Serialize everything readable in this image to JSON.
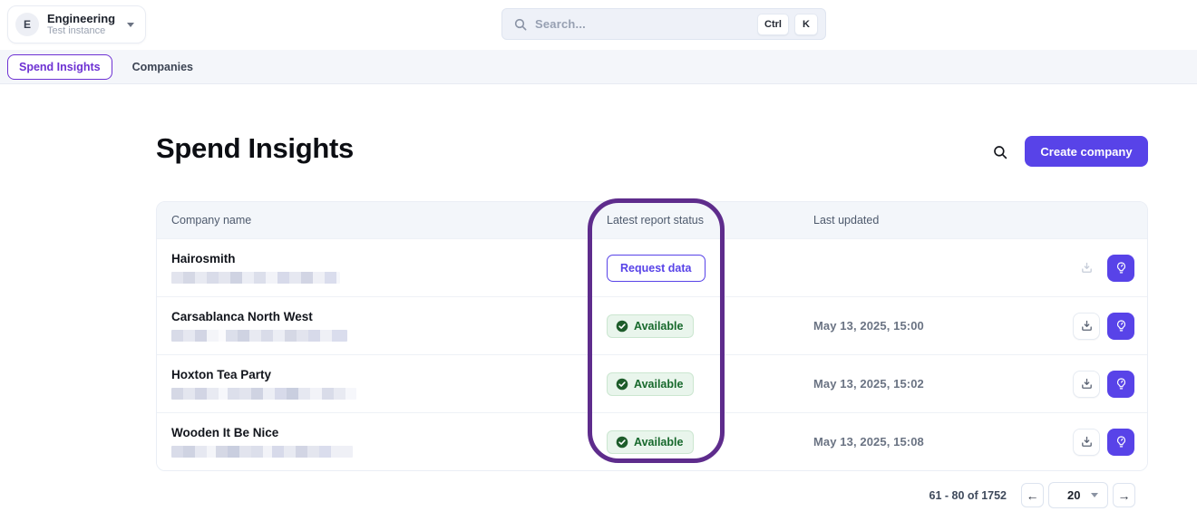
{
  "topbar": {
    "org": {
      "initial": "E",
      "name": "Engineering",
      "subtitle": "Test instance"
    },
    "search": {
      "placeholder": "Search...",
      "shortcut_keys": [
        "Ctrl",
        "K"
      ]
    }
  },
  "nav": {
    "tabs": [
      {
        "label": "Spend Insights",
        "active": true
      },
      {
        "label": "Companies",
        "active": false
      }
    ]
  },
  "page": {
    "title": "Spend Insights",
    "create_button_label": "Create company"
  },
  "table": {
    "columns": [
      "Company name",
      "Latest report status",
      "Last updated"
    ],
    "rows": [
      {
        "name": "Hairosmith",
        "address_redacted": true,
        "status": "Request data",
        "status_type": "request",
        "last_updated": "",
        "download_enabled": false
      },
      {
        "name": "Carsablanca North West",
        "address_redacted": true,
        "status": "Available",
        "status_type": "available",
        "last_updated": "May 13, 2025, 15:00",
        "download_enabled": true
      },
      {
        "name": "Hoxton Tea Party",
        "address_redacted": true,
        "status": "Available",
        "status_type": "available",
        "last_updated": "May 13, 2025, 15:02",
        "download_enabled": true
      },
      {
        "name": "Wooden It Be Nice",
        "address_redacted": true,
        "status": "Available",
        "status_type": "available",
        "last_updated": "May 13, 2025, 15:08",
        "download_enabled": true
      }
    ]
  },
  "pagination": {
    "range_label": "61 - 80 of 1752",
    "page_size": "20",
    "prev_label": "←",
    "next_label": "→"
  },
  "annotation": {
    "shape": "rounded-rect-circle",
    "target": "latest-report-status-column"
  },
  "icons": {
    "search": "magnifier",
    "download": "tray-down-arrow",
    "insights": "lightbulb",
    "available_check": "check-circle",
    "dropdown": "chevron-down"
  },
  "colors": {
    "accent_purple": "#5843e8",
    "tab_purple": "#6d31d3",
    "annotation_purple": "#5e2c8c",
    "badge_green_bg": "#e9f5ec",
    "badge_green_text": "#17692c",
    "header_bg": "#f3f6fa",
    "nav_bg": "#f4f6fa"
  }
}
